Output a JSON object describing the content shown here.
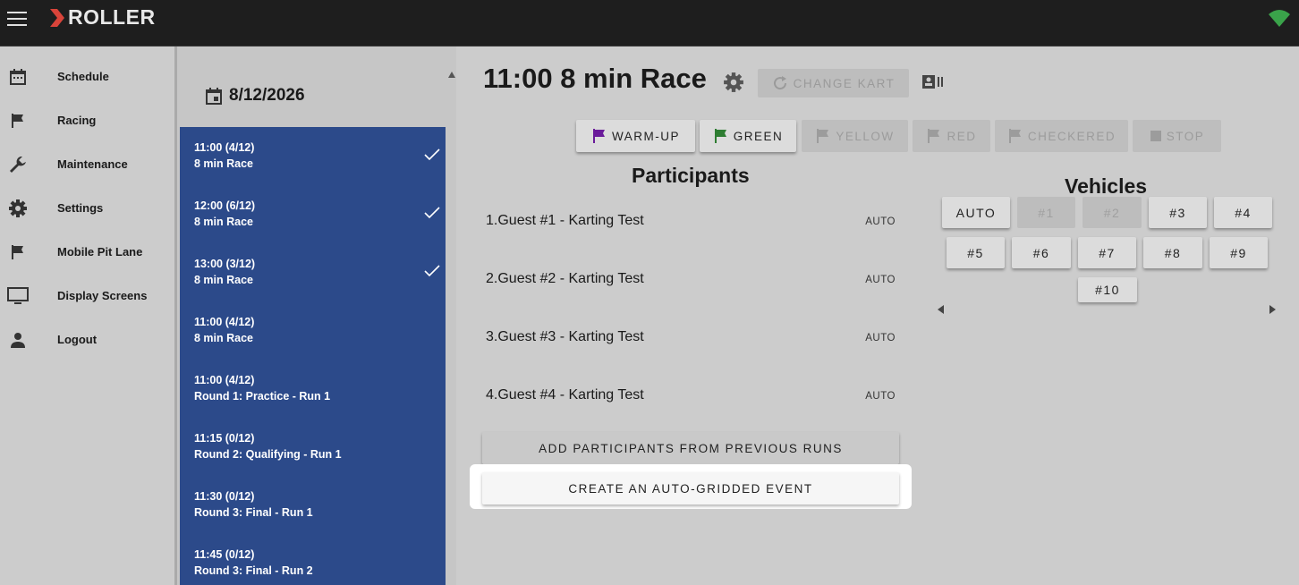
{
  "app": {
    "logo_text": "ROLLER",
    "brand_color": "#d9443a",
    "status_color": "#3aa34a"
  },
  "nav": {
    "items": [
      {
        "label": "Schedule",
        "icon": "calendar-icon"
      },
      {
        "label": "Racing",
        "icon": "flag-icon"
      },
      {
        "label": "Maintenance",
        "icon": "wrench-icon"
      },
      {
        "label": "Settings",
        "icon": "gear-icon"
      },
      {
        "label": "Mobile Pit Lane",
        "icon": "flag-icon"
      },
      {
        "label": "Display Screens",
        "icon": "monitor-icon"
      },
      {
        "label": "Logout",
        "icon": "person-icon"
      }
    ]
  },
  "schedule": {
    "date": "8/12/2026",
    "events": [
      {
        "time": "11:00 (4/12)",
        "name": "8 min Race",
        "completed": true
      },
      {
        "time": "12:00 (6/12)",
        "name": "8 min Race",
        "completed": true
      },
      {
        "time": "13:00 (3/12)",
        "name": "8 min Race",
        "completed": true
      },
      {
        "time": "11:00 (4/12)",
        "name": "8 min Race",
        "completed": false
      },
      {
        "time": "11:00 (4/12)",
        "name": "Round 1: Practice - Run 1",
        "completed": false
      },
      {
        "time": "11:15 (0/12)",
        "name": "Round 2: Qualifying - Run 1",
        "completed": false
      },
      {
        "time": "11:30 (0/12)",
        "name": "Round 3: Final - Run 1",
        "completed": false
      },
      {
        "time": "11:45 (0/12)",
        "name": "Round 3: Final - Run 2",
        "completed": false
      }
    ]
  },
  "race": {
    "title": "11:00 8 min Race",
    "change_kart_label": "CHANGE KART",
    "flags": [
      {
        "label": "WARM-UP",
        "enabled": true,
        "color": "#6a1b9a"
      },
      {
        "label": "GREEN",
        "enabled": true,
        "color": "#2e7d32"
      },
      {
        "label": "YELLOW",
        "enabled": false,
        "color": "#9c9c9c"
      },
      {
        "label": "RED",
        "enabled": false,
        "color": "#9c9c9c"
      },
      {
        "label": "CHECKERED",
        "enabled": false,
        "color": "#9c9c9c"
      },
      {
        "label": "STOP",
        "enabled": false,
        "color": "#9c9c9c"
      }
    ]
  },
  "participants": {
    "title": "Participants",
    "list": [
      {
        "name": "1.Guest #1 - Karting Test",
        "vehicle": "AUTO"
      },
      {
        "name": "2.Guest #2 - Karting Test",
        "vehicle": "AUTO"
      },
      {
        "name": "3.Guest #3 - Karting Test",
        "vehicle": "AUTO"
      },
      {
        "name": "4.Guest #4 - Karting Test",
        "vehicle": "AUTO"
      }
    ],
    "add_previous_label": "ADD PARTICIPANTS FROM PREVIOUS RUNS",
    "create_autogrid_label": "CREATE AN AUTO-GRIDDED EVENT"
  },
  "vehicles": {
    "title": "Vehicles",
    "buttons": [
      {
        "label": "AUTO",
        "enabled": true
      },
      {
        "label": "#1",
        "enabled": false
      },
      {
        "label": "#2",
        "enabled": false
      },
      {
        "label": "#3",
        "enabled": true
      },
      {
        "label": "#4",
        "enabled": true
      },
      {
        "label": "#5",
        "enabled": true
      },
      {
        "label": "#6",
        "enabled": true
      },
      {
        "label": "#7",
        "enabled": true
      },
      {
        "label": "#8",
        "enabled": true
      },
      {
        "label": "#9",
        "enabled": true
      },
      {
        "label": "#10",
        "enabled": true
      }
    ]
  }
}
